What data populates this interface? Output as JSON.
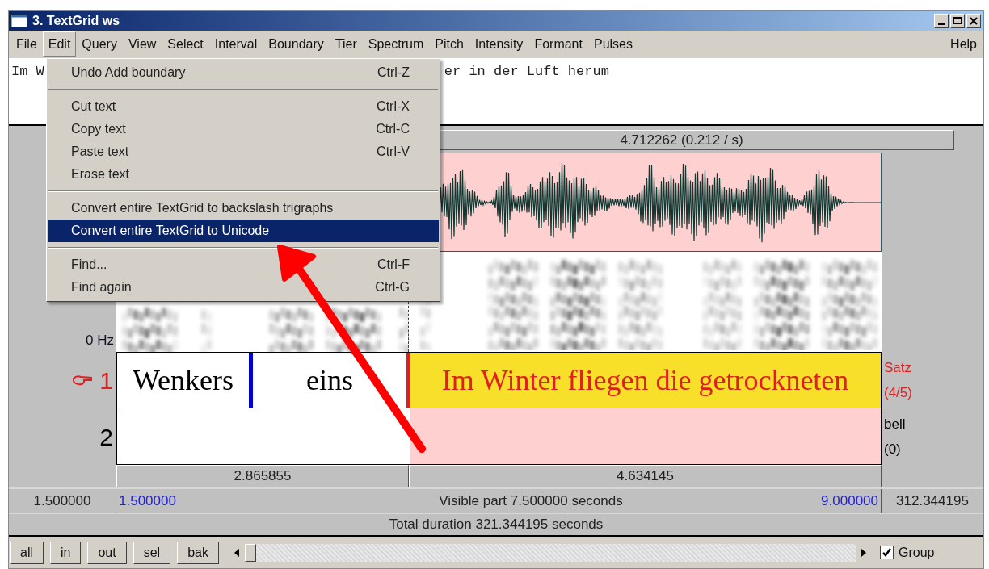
{
  "window": {
    "title": "3. TextGrid ws"
  },
  "menu_bar": {
    "items": [
      {
        "label": "File",
        "selected": false
      },
      {
        "label": "Edit",
        "selected": true
      },
      {
        "label": "Query",
        "selected": false
      },
      {
        "label": "View",
        "selected": false
      },
      {
        "label": "Select",
        "selected": false
      },
      {
        "label": "Interval",
        "selected": false
      },
      {
        "label": "Boundary",
        "selected": false
      },
      {
        "label": "Tier",
        "selected": false
      },
      {
        "label": "Spectrum",
        "selected": false
      },
      {
        "label": "Pitch",
        "selected": false
      },
      {
        "label": "Intensity",
        "selected": false
      },
      {
        "label": "Formant",
        "selected": false
      },
      {
        "label": "Pulses",
        "selected": false
      }
    ],
    "help": "Help"
  },
  "text_field": {
    "visible_start": "Im W",
    "visible_end": "er in der Luft herum"
  },
  "edit_menu": {
    "sections": [
      [
        {
          "label": "Undo Add boundary",
          "shortcut": "Ctrl-Z",
          "selected": false
        }
      ],
      [
        {
          "label": "Cut text",
          "shortcut": "Ctrl-X",
          "selected": false
        },
        {
          "label": "Copy text",
          "shortcut": "Ctrl-C",
          "selected": false
        },
        {
          "label": "Paste text",
          "shortcut": "Ctrl-V",
          "selected": false
        },
        {
          "label": "Erase text",
          "selected": false
        }
      ],
      [
        {
          "label": "Convert entire TextGrid to backslash trigraphs",
          "selected": false
        },
        {
          "label": "Convert entire TextGrid to Unicode",
          "selected": true
        }
      ],
      [
        {
          "label": "Find...",
          "shortcut": "Ctrl-F",
          "selected": false
        },
        {
          "label": "Find again",
          "shortcut": "Ctrl-G",
          "selected": false
        }
      ]
    ]
  },
  "selection_time": "4.712262 (0.212 / s)",
  "frequency_label": "0 Hz",
  "tiers": [
    {
      "number": "1",
      "selected": true,
      "name": "Satz",
      "count": "(4/5)",
      "intervals": [
        {
          "text": "Wenkers",
          "selected": false
        },
        {
          "text": "eins",
          "selected": false
        },
        {
          "text": "Im Winter fliegen die getrockneten",
          "selected": true
        }
      ]
    },
    {
      "number": "2",
      "selected": false,
      "name": "bell",
      "count": "(0)"
    }
  ],
  "durations": [
    "2.865855",
    "4.634145"
  ],
  "window_start": "1.500000",
  "visible_start": "1.500000",
  "visible_label": "Visible part 7.500000 seconds",
  "visible_end": "9.000000",
  "window_end": "312.344195",
  "total": "Total duration 321.344195 seconds",
  "buttons": [
    "all",
    "in",
    "out",
    "sel",
    "bak"
  ],
  "group_checkbox": {
    "label": "Group",
    "checked": true
  }
}
